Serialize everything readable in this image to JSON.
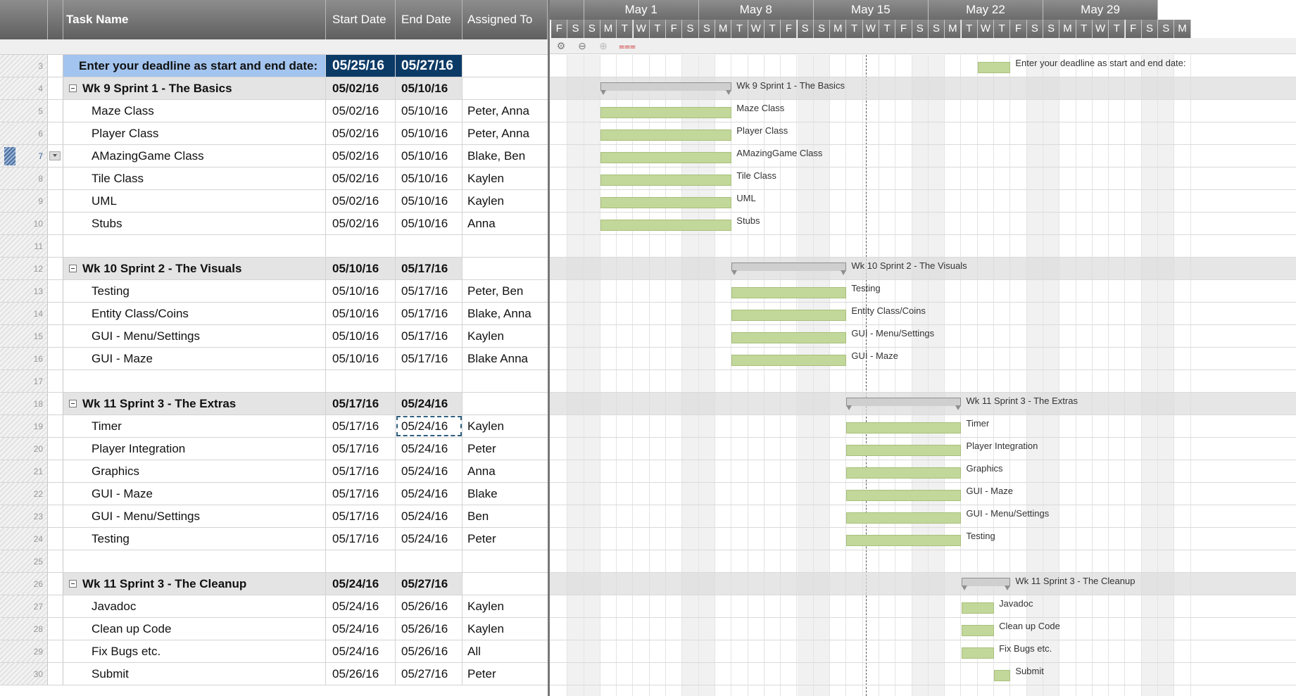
{
  "columns": {
    "task_name": "Task Name",
    "start_date": "Start Date",
    "end_date": "End Date",
    "assigned_to": "Assigned To"
  },
  "rows": [
    {
      "num": "3",
      "kind": "deadline",
      "name": "Enter your deadline as start and end date:",
      "start": "05/25/16",
      "end": "05/27/16",
      "assigned": ""
    },
    {
      "num": "4",
      "kind": "parent",
      "name": "Wk 9 Sprint 1 - The Basics",
      "start": "05/02/16",
      "end": "05/10/16",
      "assigned": ""
    },
    {
      "num": "5",
      "kind": "child",
      "name": "Maze Class",
      "start": "05/02/16",
      "end": "05/10/16",
      "assigned": "Peter, Anna"
    },
    {
      "num": "6",
      "kind": "child",
      "name": "Player Class",
      "start": "05/02/16",
      "end": "05/10/16",
      "assigned": "Peter, Anna"
    },
    {
      "num": "7",
      "kind": "child",
      "name": "AMazingGame Class",
      "start": "05/02/16",
      "end": "05/10/16",
      "assigned": "Blake, Ben",
      "selected": true
    },
    {
      "num": "8",
      "kind": "child",
      "name": "Tile Class",
      "start": "05/02/16",
      "end": "05/10/16",
      "assigned": "Kaylen"
    },
    {
      "num": "9",
      "kind": "child",
      "name": "UML",
      "start": "05/02/16",
      "end": "05/10/16",
      "assigned": "Kaylen"
    },
    {
      "num": "10",
      "kind": "child",
      "name": "Stubs",
      "start": "05/02/16",
      "end": "05/10/16",
      "assigned": "Anna"
    },
    {
      "num": "11",
      "kind": "blank",
      "name": "",
      "start": "",
      "end": "",
      "assigned": ""
    },
    {
      "num": "12",
      "kind": "parent",
      "name": "Wk 10 Sprint 2 - The Visuals",
      "start": "05/10/16",
      "end": "05/17/16",
      "assigned": ""
    },
    {
      "num": "13",
      "kind": "child",
      "name": "Testing",
      "start": "05/10/16",
      "end": "05/17/16",
      "assigned": "Peter, Ben"
    },
    {
      "num": "14",
      "kind": "child",
      "name": "Entity Class/Coins",
      "start": "05/10/16",
      "end": "05/17/16",
      "assigned": "Blake, Anna"
    },
    {
      "num": "15",
      "kind": "child",
      "name": "GUI - Menu/Settings",
      "start": "05/10/16",
      "end": "05/17/16",
      "assigned": "Kaylen"
    },
    {
      "num": "16",
      "kind": "child",
      "name": "GUI - Maze",
      "start": "05/10/16",
      "end": "05/17/16",
      "assigned": "Blake Anna"
    },
    {
      "num": "17",
      "kind": "blank",
      "name": "",
      "start": "",
      "end": "",
      "assigned": ""
    },
    {
      "num": "18",
      "kind": "parent",
      "name": "Wk 11 Sprint 3 - The Extras",
      "start": "05/17/16",
      "end": "05/24/16",
      "assigned": ""
    },
    {
      "num": "19",
      "kind": "child",
      "name": "Timer",
      "start": "05/17/16",
      "end": "05/24/16",
      "assigned": "Kaylen",
      "focus_end": true
    },
    {
      "num": "20",
      "kind": "child",
      "name": "Player Integration",
      "start": "05/17/16",
      "end": "05/24/16",
      "assigned": "Peter"
    },
    {
      "num": "21",
      "kind": "child",
      "name": "Graphics",
      "start": "05/17/16",
      "end": "05/24/16",
      "assigned": "Anna"
    },
    {
      "num": "22",
      "kind": "child",
      "name": "GUI - Maze",
      "start": "05/17/16",
      "end": "05/24/16",
      "assigned": "Blake"
    },
    {
      "num": "23",
      "kind": "child",
      "name": "GUI - Menu/Settings",
      "start": "05/17/16",
      "end": "05/24/16",
      "assigned": "Ben"
    },
    {
      "num": "24",
      "kind": "child",
      "name": "Testing",
      "start": "05/17/16",
      "end": "05/24/16",
      "assigned": "Peter"
    },
    {
      "num": "25",
      "kind": "blank",
      "name": "",
      "start": "",
      "end": "",
      "assigned": ""
    },
    {
      "num": "26",
      "kind": "parent",
      "name": "Wk 11 Sprint 3 - The Cleanup",
      "start": "05/24/16",
      "end": "05/27/16",
      "assigned": ""
    },
    {
      "num": "27",
      "kind": "child",
      "name": "Javadoc",
      "start": "05/24/16",
      "end": "05/26/16",
      "assigned": "Kaylen"
    },
    {
      "num": "28",
      "kind": "child",
      "name": "Clean up Code",
      "start": "05/24/16",
      "end": "05/26/16",
      "assigned": "Kaylen"
    },
    {
      "num": "29",
      "kind": "child",
      "name": "Fix Bugs etc.",
      "start": "05/24/16",
      "end": "05/26/16",
      "assigned": "All"
    },
    {
      "num": "30",
      "kind": "child",
      "name": "Submit",
      "start": "05/26/16",
      "end": "05/27/16",
      "assigned": "Peter"
    }
  ],
  "gantt": {
    "weeks": [
      "May 1",
      "May 8",
      "May 15",
      "May 22",
      "May 29"
    ],
    "days": [
      "F",
      "S",
      "S",
      "M",
      "T",
      "W",
      "T",
      "F",
      "S",
      "S",
      "M",
      "T",
      "W",
      "T",
      "F",
      "S",
      "S",
      "M",
      "T",
      "W",
      "T",
      "F",
      "S",
      "S",
      "M",
      "T",
      "W",
      "T",
      "F",
      "S",
      "S",
      "M",
      "T",
      "W",
      "T",
      "F",
      "S",
      "S",
      "M"
    ],
    "first_day": "2016-04-29",
    "today": "2016-05-18",
    "toolbar_icons": [
      "settings-gear-icon",
      "zoom-out-icon",
      "zoom-in-icon",
      "critical-path-icon"
    ]
  },
  "colors": {
    "task_bar": "#c2d79a",
    "summary_bar": "#cfcfcf",
    "deadline_cell": "#0c3a66",
    "deadline_label": "#a3c4ee"
  }
}
